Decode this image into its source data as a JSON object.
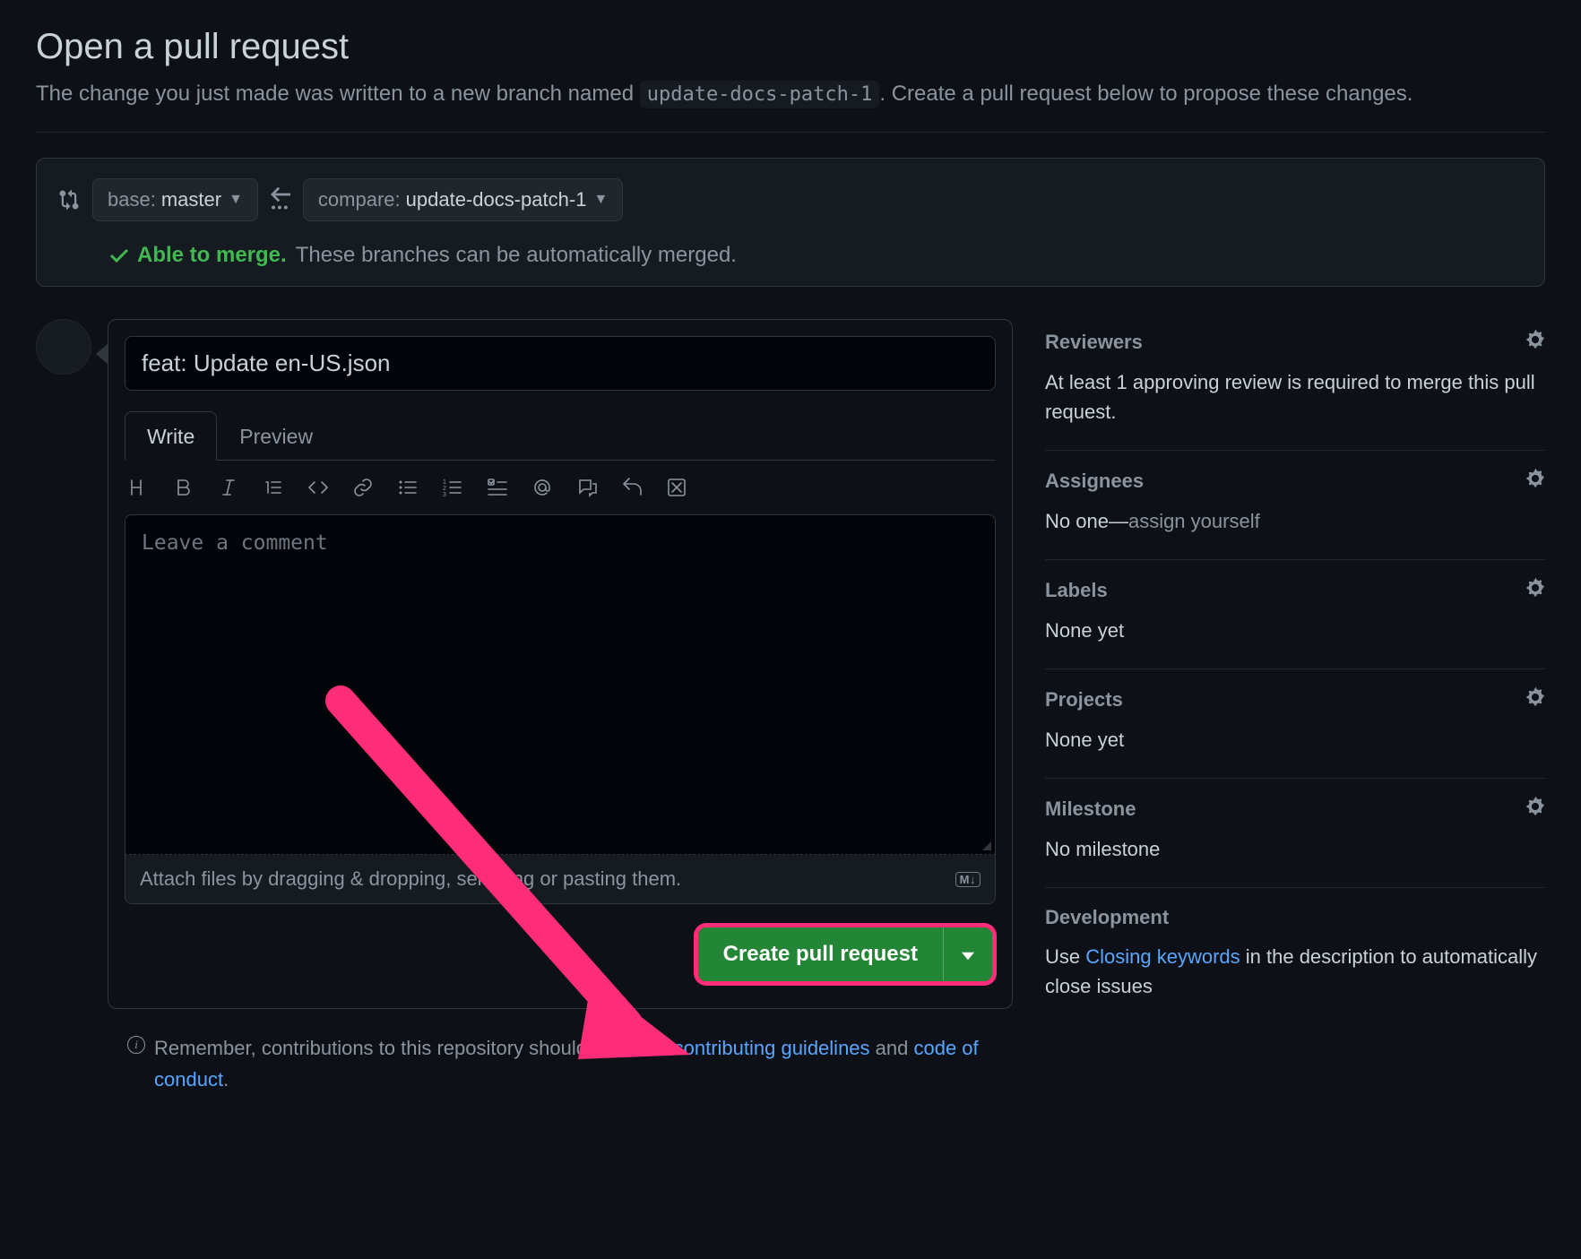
{
  "page": {
    "title": "Open a pull request",
    "subtitle_a": "The change you just made was written to a new branch named ",
    "branch_name": "update-docs-patch-1",
    "subtitle_b": ". Create a pull request below to propose these changes."
  },
  "range": {
    "base_label": "base:",
    "base_value": "master",
    "compare_label": "compare:",
    "compare_value": "update-docs-patch-1",
    "able_label": "Able to merge.",
    "able_desc": "These branches can be automatically merged."
  },
  "form": {
    "title_value": "feat: Update en-US.json",
    "tabs": {
      "write": "Write",
      "preview": "Preview"
    },
    "comment_placeholder": "Leave a comment",
    "attach_hint": "Attach files by dragging & dropping, selecting or pasting them.",
    "md_badge": "M↓",
    "create_button": "Create pull request"
  },
  "footnote": {
    "prefix": "Remember, contributions to this repository should follow its ",
    "link1": "contributing guidelines",
    "mid": " and ",
    "link2": "code of conduct",
    "suffix": "."
  },
  "sidebar": {
    "reviewers": {
      "title": "Reviewers",
      "body": "At least 1 approving review is required to merge this pull request."
    },
    "assignees": {
      "title": "Assignees",
      "prefix": "No one—",
      "link": "assign yourself"
    },
    "labels": {
      "title": "Labels",
      "body": "None yet"
    },
    "projects": {
      "title": "Projects",
      "body": "None yet"
    },
    "milestone": {
      "title": "Milestone",
      "body": "No milestone"
    },
    "development": {
      "title": "Development",
      "prefix": "Use ",
      "link": "Closing keywords",
      "suffix": " in the description to automatically close issues"
    }
  }
}
